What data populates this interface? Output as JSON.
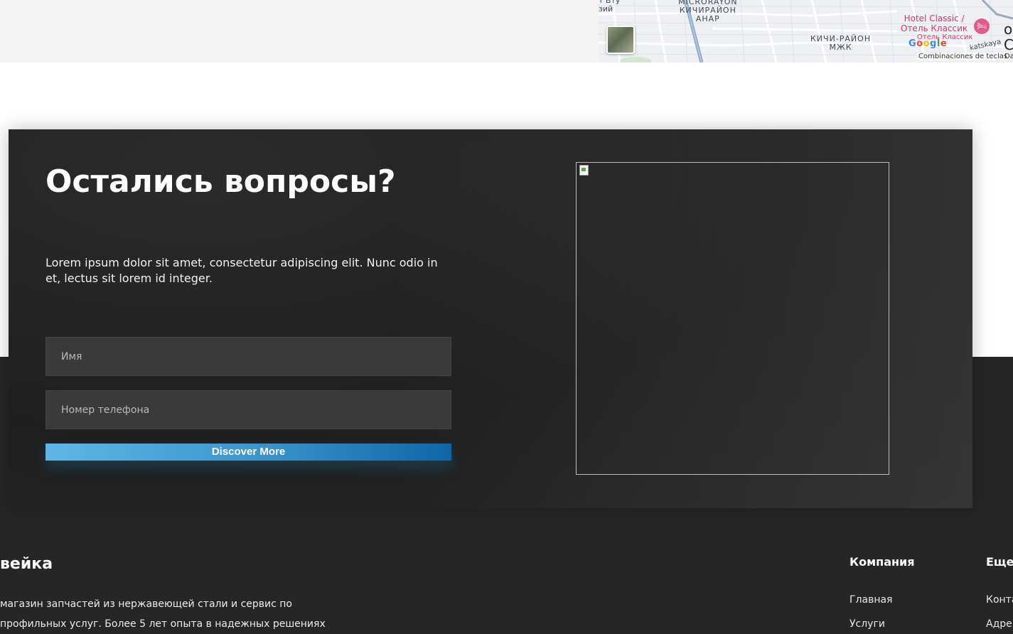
{
  "map": {
    "labels": {
      "top_left": "т Вту\nзий",
      "microrayon": "MICRORAYON\nКИЧИРАЙОН\nАНАР",
      "kichi_rayon": "КИЧИ-РАЙОН\nМЖК",
      "street": "katskaya"
    },
    "hotel_name": "Hotel Classic /\nОтель Классик",
    "hotel_sub": "Отель Классик",
    "hotel_icon": "bed-icon",
    "google_logo": [
      "G",
      "o",
      "o",
      "g",
      "l",
      "e"
    ],
    "keyboard_shortcuts": "Combinaciones de teclas",
    "edge_text": "Da",
    "edge_big": "o\nC"
  },
  "contact": {
    "title": "Остались вопросы?",
    "text": "Lorem ipsum dolor sit amet, consectetur adipiscing elit. Nunc odio in et, lectus sit lorem id integer.",
    "name_placeholder": "Имя",
    "phone_placeholder": "Номер телефона",
    "submit_label": "Discover More",
    "image_icon": "broken-image-icon"
  },
  "footer": {
    "brand": "вейка",
    "description": "магазин запчастей из нержавеющей стали и сервис по профильных услуг. Более 5 лет опыта в надежных решениях",
    "company": {
      "title": "Компания",
      "links": [
        "Главная",
        "Услуги"
      ]
    },
    "more": {
      "title": "Еще",
      "links": [
        "Конта",
        "Адре"
      ]
    }
  },
  "colors": {
    "card_bg": "#1f1f1f",
    "button_gradient_start": "#5fb6e6",
    "button_gradient_end": "#0f66a6",
    "footer_bg": "#262626",
    "hotel_accent": "#d6336c"
  }
}
